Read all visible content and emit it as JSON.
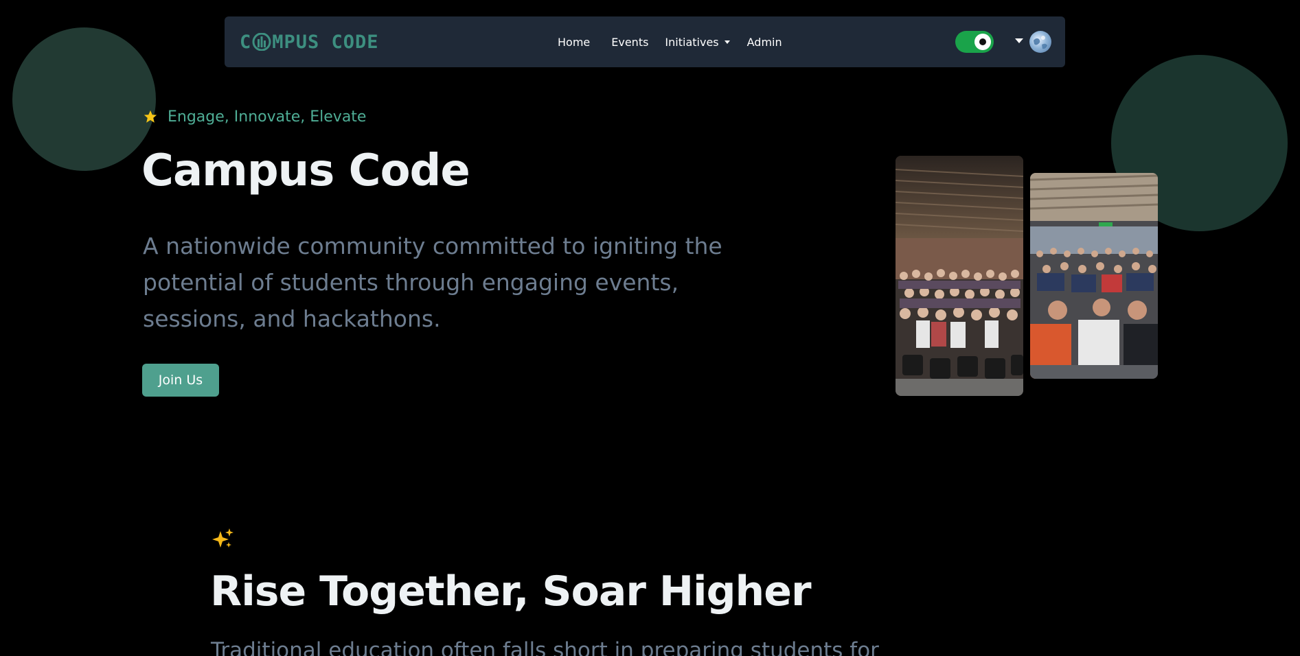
{
  "colors": {
    "background": "#000000",
    "navbar_bg": "#1f2937",
    "accent": "#4fa08e",
    "tagline": "#4fae96",
    "muted_text": "#6d7d90",
    "blob_left": "#223a33",
    "blob_right": "#1b352e",
    "toggle_on": "#1aa34a",
    "star": "#f5c518"
  },
  "navbar": {
    "logo_text_pre": "C",
    "logo_text_post": "MPUS CODE",
    "logo_icon": "city-skyline-icon",
    "links": [
      "Home",
      "Events",
      "Initiatives",
      "Admin"
    ],
    "initiatives_dropdown_icon": "caret-down-icon",
    "theme_toggle_state": "on",
    "profile_dropdown_icon": "caret-down-icon",
    "avatar_icon": "avatar-globe-icon"
  },
  "hero": {
    "tagline_icon": "star-icon",
    "tagline": "Engage, Innovate, Elevate",
    "title": "Campus Code",
    "description": "A nationwide community committed to igniting the potential of students through engaging events, sessions, and hackathons.",
    "cta_label": "Join Us",
    "photos": [
      "group-photo-auditorium",
      "group-photo-workshop"
    ]
  },
  "section": {
    "icon": "sparkles-icon",
    "title": "Rise Together, Soar Higher",
    "text_partial": "Traditional education often falls short in preparing students for"
  }
}
